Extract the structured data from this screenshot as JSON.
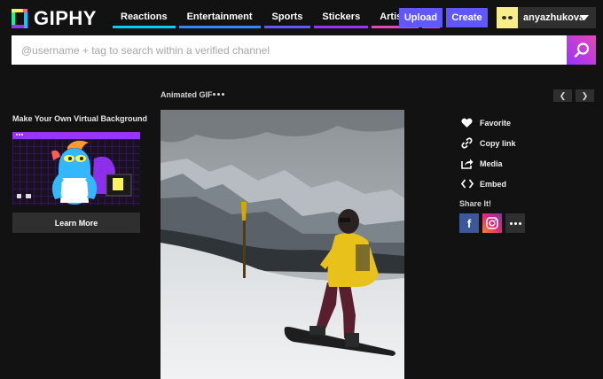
{
  "brand": {
    "name": "GIPHY"
  },
  "nav": {
    "items": [
      {
        "label": "Reactions",
        "color": "#00ccff"
      },
      {
        "label": "Entertainment",
        "color": "#3388ff"
      },
      {
        "label": "Sports",
        "color": "#6157ff"
      },
      {
        "label": "Stickers",
        "color": "#9933ff"
      },
      {
        "label": "Artists",
        "color": "#e646b6"
      }
    ],
    "more_icon": "more-vertical-icon"
  },
  "header": {
    "upload_label": "Upload",
    "create_label": "Create",
    "username": "anyazhukova",
    "accent": "#6157ff"
  },
  "search": {
    "placeholder": "@username + tag to search within a verified channel",
    "icon": "search-icon"
  },
  "sidebar": {
    "title": "Make Your Own Virtual Background",
    "button_label": "Learn More"
  },
  "main": {
    "gif_title": "Animated GIF",
    "prev_icon": "chevron-left-icon",
    "next_icon": "chevron-right-icon"
  },
  "actions": {
    "items": [
      {
        "label": "Favorite",
        "icon": "heart-icon"
      },
      {
        "label": "Copy link",
        "icon": "link-icon"
      },
      {
        "label": "Media",
        "icon": "share-out-icon"
      },
      {
        "label": "Embed",
        "icon": "code-icon"
      }
    ],
    "share_title": "Share It!",
    "facebook_letter": "f"
  }
}
